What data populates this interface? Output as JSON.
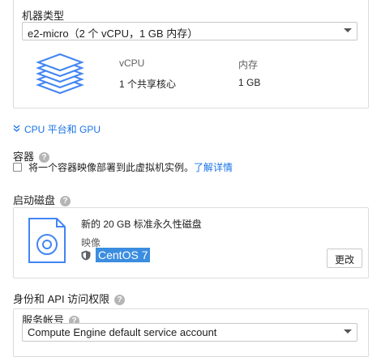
{
  "machine_type": {
    "label": "机器类型",
    "selected": "e2-micro（2 个 vCPU，1 GB 内存）",
    "vcpu_header": "vCPU",
    "vcpu_value": "1 个共享核心",
    "memory_header": "内存",
    "memory_value": "1 GB"
  },
  "cpu_platform": {
    "label": "CPU 平台和 GPU",
    "icon": "chevron-double-down-icon"
  },
  "container": {
    "label": "容器",
    "checkbox_text": "将一个容器映像部署到此虚拟机实例。",
    "learn_more": "了解详情"
  },
  "boot_disk": {
    "label": "启动磁盘",
    "description": "新的 20 GB 标准永久性磁盘",
    "image_label": "映像",
    "image_name": "CentOS 7",
    "change_button": "更改"
  },
  "identity": {
    "label": "身份和 API 访问权限",
    "service_account_label": "服务帐号",
    "service_account_value": "Compute Engine default service account"
  },
  "colors": {
    "accent": "#1a73e8",
    "highlight": "#3b8de0",
    "disk_icon": "#4285f4"
  }
}
